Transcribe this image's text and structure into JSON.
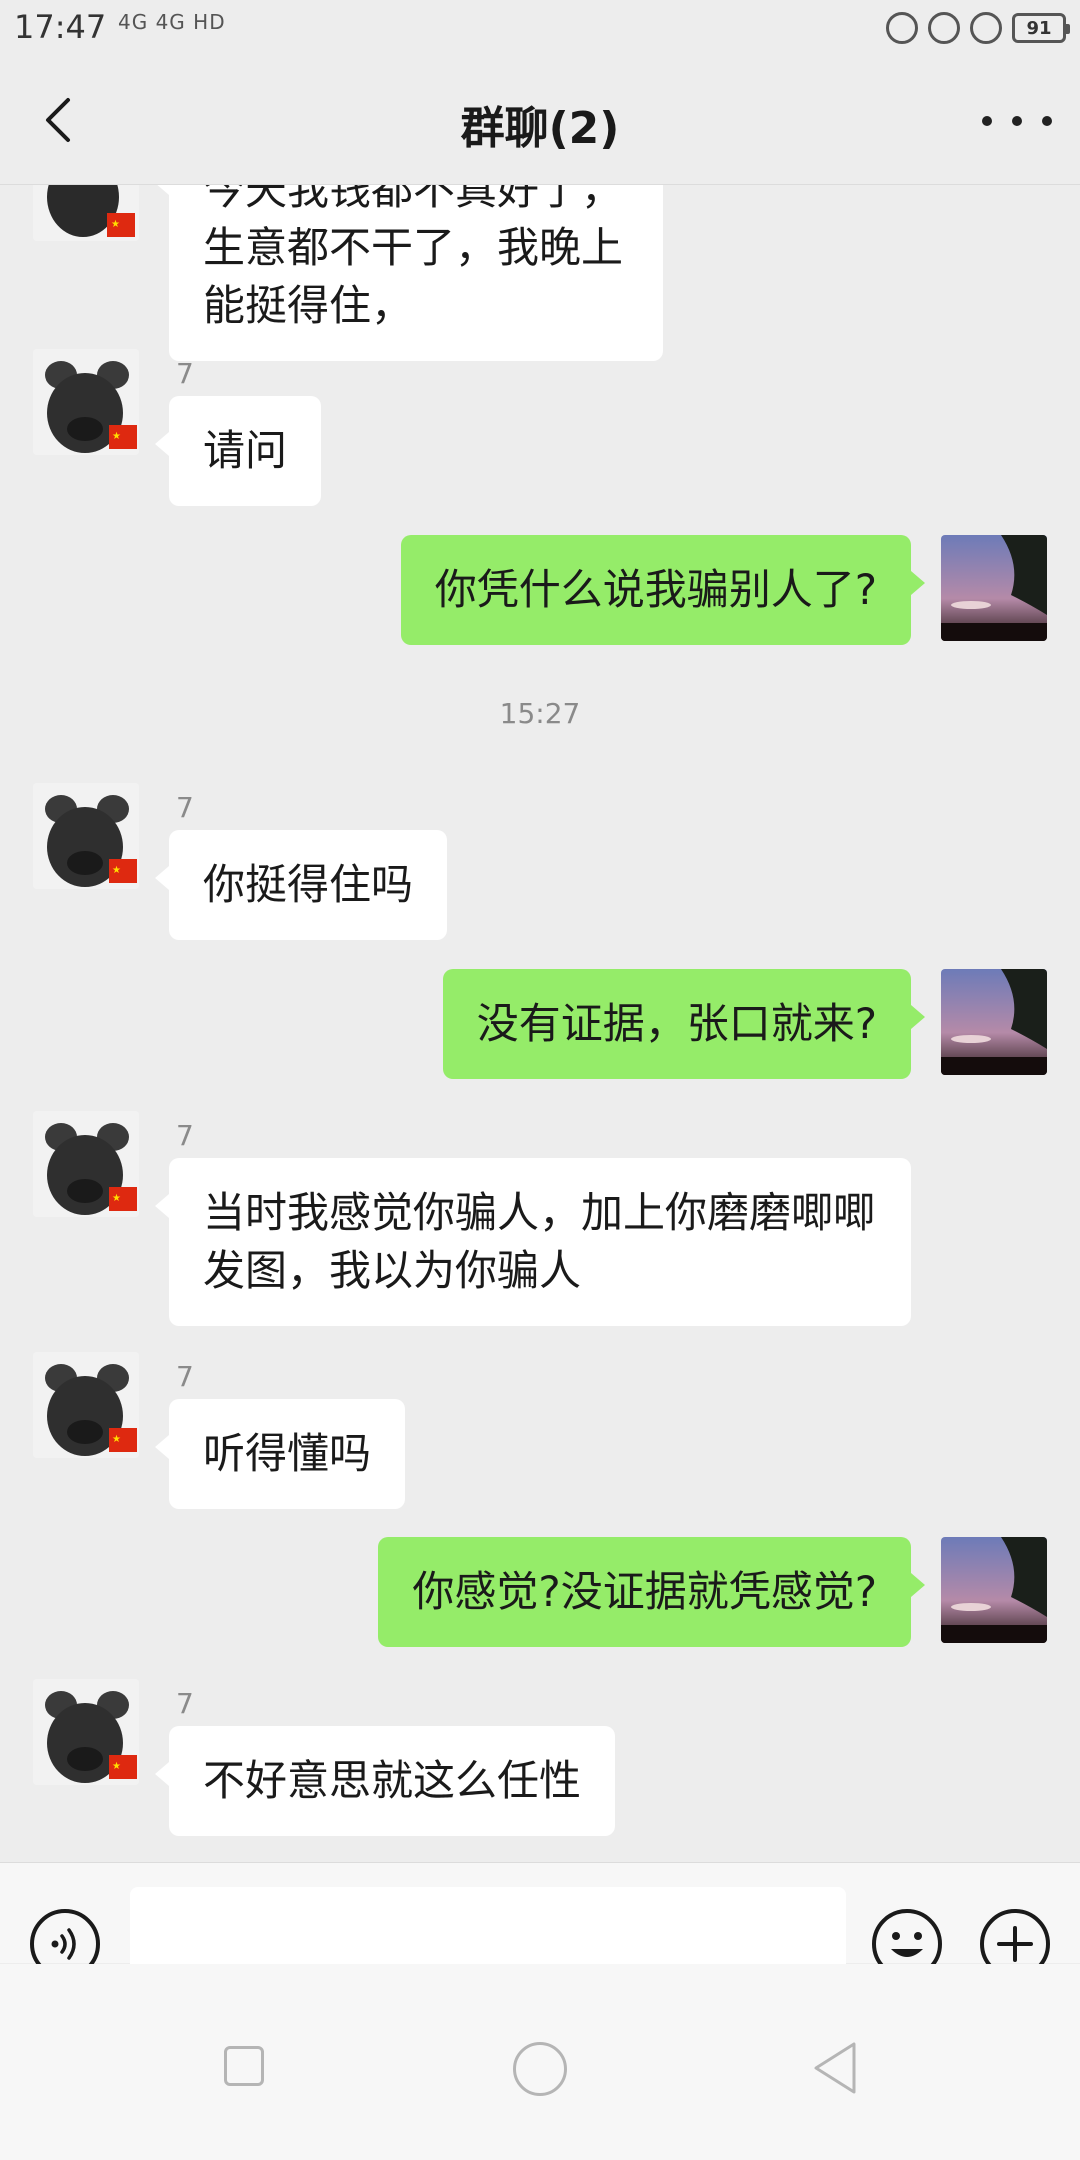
{
  "status_bar": {
    "time": "17:47",
    "network": "4G 4G HD",
    "battery": "91"
  },
  "header": {
    "title": "群聊(2)"
  },
  "messages": [
    {
      "side": "in",
      "sender": "",
      "text": "今天我钱都不真好了，生意都不干了，我晚上能挺得住，"
    },
    {
      "side": "in",
      "sender": "7",
      "text": "请问"
    },
    {
      "side": "out",
      "text": "你凭什么说我骗别人了?"
    },
    {
      "side": "time",
      "text": "15:27"
    },
    {
      "side": "in",
      "sender": "7",
      "text": "你挺得住吗"
    },
    {
      "side": "out",
      "text": "没有证据，张口就来?"
    },
    {
      "side": "in",
      "sender": "7",
      "text": "当时我感觉你骗人，加上你磨磨唧唧发图，我以为你骗人"
    },
    {
      "side": "in",
      "sender": "7",
      "text": "听得懂吗"
    },
    {
      "side": "out",
      "text": "你感觉?没证据就凭感觉?"
    },
    {
      "side": "in",
      "sender": "7",
      "text": "不好意思就这么任性"
    }
  ],
  "input": {
    "value": ""
  },
  "icons": {
    "back": "chevron-left-icon",
    "more": "more-dots-icon",
    "voice": "voice-icon",
    "emoji": "emoji-icon",
    "plus": "plus-icon"
  },
  "colors": {
    "outgoing_bubble": "#95ec69",
    "incoming_bubble": "#ffffff",
    "background": "#ededed"
  }
}
